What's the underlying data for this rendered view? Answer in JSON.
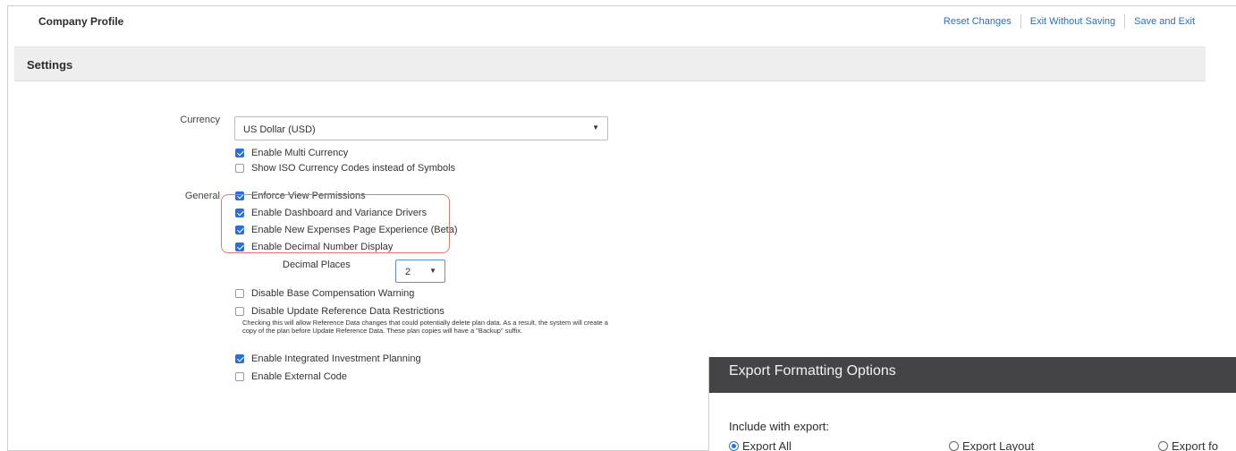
{
  "header": {
    "title": "Company Profile",
    "actions": [
      "Reset Changes",
      "Exit Without Saving",
      "Save and Exit"
    ]
  },
  "settings": {
    "title": "Settings",
    "currency": {
      "label": "Currency",
      "selected": "US Dollar (USD)",
      "options": [
        {
          "label": "Enable Multi Currency",
          "checked": true
        },
        {
          "label": "Show ISO Currency Codes instead of Symbols",
          "checked": false
        }
      ]
    },
    "general": {
      "label": "General",
      "options": [
        {
          "label": "Enforce View Permissions",
          "checked": true
        },
        {
          "label": "Enable Dashboard and Variance Drivers",
          "checked": true
        },
        {
          "label": "Enable New Expenses Page Experience (Beta)",
          "checked": true
        },
        {
          "label": "Enable Decimal Number Display",
          "checked": true
        },
        {
          "label": "Disable Base Compensation Warning",
          "checked": false
        },
        {
          "label": "Disable Update Reference Data Restrictions",
          "checked": false
        },
        {
          "label": "Enable Integrated Investment Planning",
          "checked": true
        },
        {
          "label": "Enable External Code",
          "checked": false
        }
      ],
      "decimal_places_label": "Decimal Places",
      "decimal_places_value": "2",
      "reference_note": "Checking this will allow Reference Data changes that could potentially delete plan data. As a result, the system will create a copy of the plan before Update Reference Data. These plan copies will have a \"Backup\" suffix."
    }
  },
  "export_dialog": {
    "title": "Export Formatting Options",
    "subtitle": "Include with export:",
    "radios": [
      {
        "label": "Export All",
        "selected": true
      },
      {
        "label": "Export Layout",
        "selected": false
      },
      {
        "label": "Export fo",
        "selected": false
      }
    ]
  },
  "colors": {
    "link": "#2a6fb6",
    "checkbox": "#2d6fd6",
    "highlight": "#e07a6f",
    "dialog_header": "#444447"
  }
}
